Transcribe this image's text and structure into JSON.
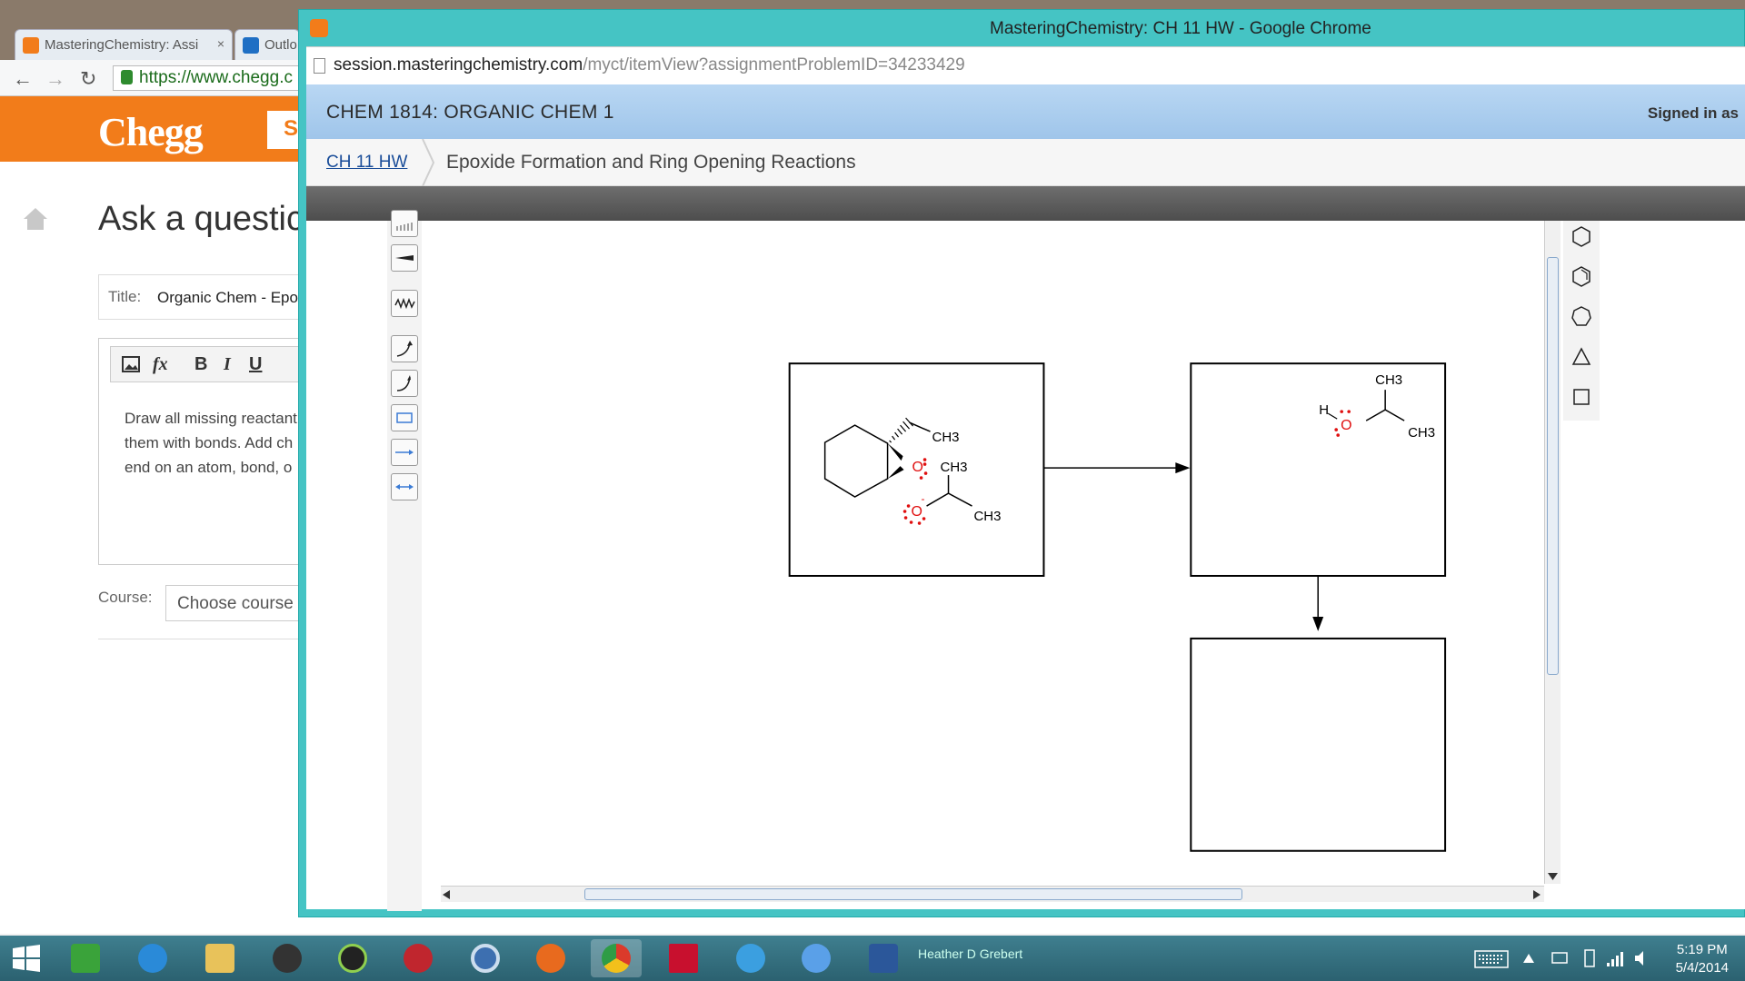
{
  "background_window": {
    "tabs": [
      {
        "label": "MasteringChemistry: Assi"
      },
      {
        "label": "Outlo"
      }
    ],
    "close_glyph": "×",
    "omnibox_text": "https://www.chegg.c",
    "brand": "Chegg",
    "search_button_fragment": "S",
    "heading": "Ask a questic",
    "title_label": "Title:",
    "title_value": "Organic Chem - Epo",
    "editor_toolbar": [
      "B",
      "I",
      "U"
    ],
    "editor_lines": [
      "Draw all missing reactant",
      "them with bonds. Add ch",
      "end on an atom, bond, o"
    ],
    "course_label": "Course:",
    "course_placeholder": "Choose course"
  },
  "foreground_window": {
    "title": "MasteringChemistry: CH 11 HW - Google Chrome",
    "url_host": "session.masteringchemistry.com",
    "url_path": "/myct/itemView?assignmentProblemID=34233429",
    "course": "CHEM 1814: ORGANIC CHEM 1",
    "signed_in": "Signed in as",
    "breadcrumb_link": "CH 11 HW",
    "breadcrumb_current": "Epoxide Formation and Ring Opening Reactions"
  },
  "drawing": {
    "reactant_labels": {
      "ch3_epoxide": "CH3",
      "o_epoxide": "O",
      "ch3_top": "CH3",
      "o_alkoxide": "O",
      "ch3_bottom": "CH3",
      "charge": "-"
    },
    "product_labels": {
      "ch3_top": "CH3",
      "h": "H",
      "o": "O",
      "ch3_right": "CH3"
    },
    "colors": {
      "heteroatom": "#e01010",
      "bond": "#000000"
    }
  },
  "taskbar": {
    "apps": [
      "windows-store-icon",
      "internet-explorer-icon",
      "file-explorer-icon",
      "media-icon",
      "itunes-icon",
      "record-icon",
      "disc-icon",
      "firefox-icon",
      "chrome-icon",
      "kaspersky-icon",
      "quicktime-icon",
      "itunes-icon",
      "word-icon"
    ],
    "tray_user": "Heather D Grebert",
    "time": "5:19 PM",
    "date": "5/4/2014"
  }
}
